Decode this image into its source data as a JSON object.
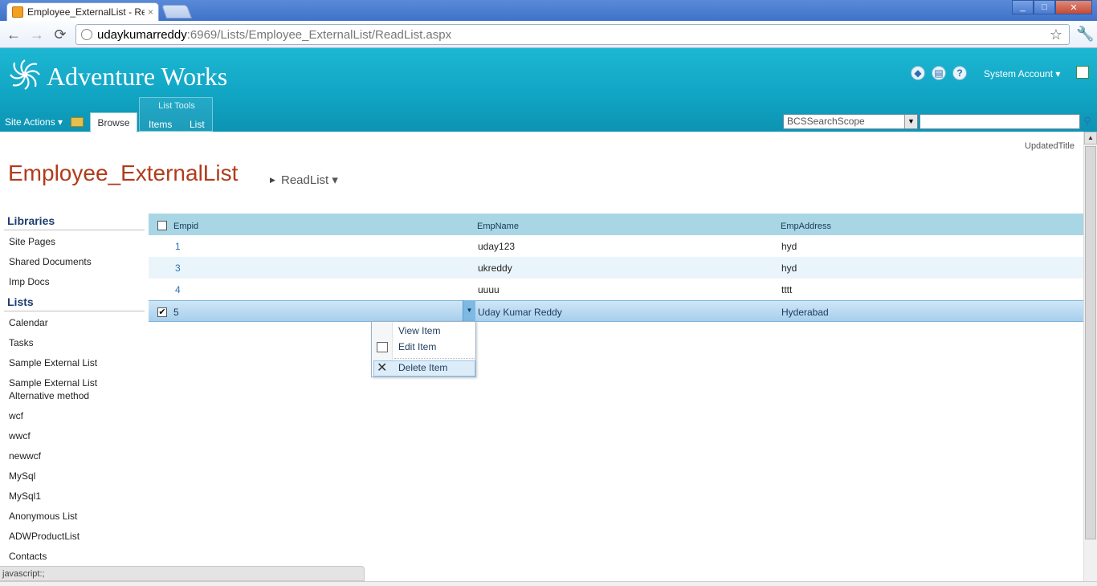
{
  "browser": {
    "tab_title": "Employee_ExternalList - Reac",
    "tab_close": "×",
    "url_host": "udaykumarreddy",
    "url_rest": ":6969/Lists/Employee_ExternalList/ReadList.aspx",
    "back": "←",
    "forward": "→",
    "reload": "⟳",
    "bookmark": "☆",
    "menu": "🔧",
    "win_min": "_",
    "win_max": "□",
    "win_close": "✕"
  },
  "header": {
    "site_title": "Adventure Works",
    "site_actions": "Site Actions ▾",
    "tabs": {
      "browse": "Browse",
      "list_tools": "List Tools",
      "items": "Items",
      "list": "List"
    },
    "search_scope": "BCSSearchScope",
    "scope_arrow": "▼",
    "search_button": "⚲",
    "help": "?",
    "user": "System Account ▾"
  },
  "page": {
    "updated_title": "UpdatedTitle",
    "title": "Employee_ExternalList",
    "breadcrumb_arrow": "▶",
    "view": "ReadList ▾"
  },
  "quick_launch": {
    "libraries_heading": "Libraries",
    "libraries": [
      "Site Pages",
      "Shared Documents",
      "Imp Docs"
    ],
    "lists_heading": "Lists",
    "lists": [
      "Calendar",
      "Tasks",
      "Sample External List",
      "Sample External List Alternative method",
      "wcf",
      "wwcf",
      "newwcf",
      "MySql",
      "MySql1",
      "Anonymous List",
      "ADWProductList",
      "Contacts"
    ]
  },
  "grid": {
    "columns": [
      "Empid",
      "EmpName",
      "EmpAddress"
    ],
    "rows": [
      {
        "empid": "1",
        "name": "uday123",
        "address": "hyd"
      },
      {
        "empid": "3",
        "name": "ukreddy",
        "address": "hyd"
      },
      {
        "empid": "4",
        "name": "uuuu",
        "address": "tttt"
      },
      {
        "empid": "5",
        "name": "Uday Kumar Reddy",
        "address": "Hyderabad"
      }
    ],
    "check_mark": "✔",
    "ecb_arrow": "▼"
  },
  "context_menu": {
    "items": [
      "View Item",
      "Edit Item",
      "Delete Item"
    ],
    "delete_icon": "✕"
  },
  "status_bar": {
    "text": "javascript:;"
  },
  "colors": {
    "header_teal": "#11a5c4",
    "page_title": "#b13b1c",
    "grid_header": "#a9d6e4",
    "selected_row": "#a7cfee"
  }
}
